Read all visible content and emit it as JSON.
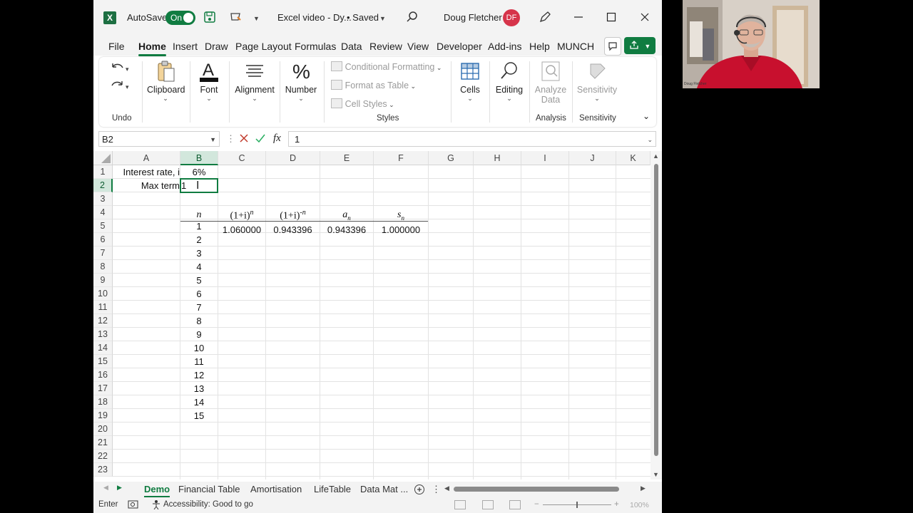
{
  "titlebar": {
    "app_icon": "X",
    "autosave_label": "AutoSave",
    "autosave_state": "On",
    "filename": "Excel video - Dy...",
    "save_status": "• Saved",
    "user_name": "Doug Fletcher",
    "user_initials": "DF"
  },
  "menu": {
    "tabs": [
      "File",
      "Home",
      "Insert",
      "Draw",
      "Page Layout",
      "Formulas",
      "Data",
      "Review",
      "View",
      "Developer",
      "Add-ins",
      "Help",
      "MUNCH"
    ],
    "active": "Home"
  },
  "ribbon": {
    "undo_group": "Undo",
    "clipboard": "Clipboard",
    "font": "Font",
    "alignment": "Alignment",
    "number": "Number",
    "conditional_formatting": "Conditional Formatting",
    "format_as_table": "Format as Table",
    "cell_styles": "Cell Styles",
    "styles_group": "Styles",
    "cells": "Cells",
    "editing": "Editing",
    "analyze_data_1": "Analyze",
    "analyze_data_2": "Data",
    "analysis_group": "Analysis",
    "sensitivity": "Sensitivity",
    "sensitivity_group": "Sensitivity"
  },
  "formula_bar": {
    "name_box": "B2",
    "fx": "fx",
    "content": "1"
  },
  "grid": {
    "columns": [
      "A",
      "B",
      "C",
      "D",
      "E",
      "F",
      "G",
      "H",
      "I",
      "J",
      "K"
    ],
    "selected_column": "B",
    "selected_row": "2",
    "rows": [
      "1",
      "2",
      "3",
      "4",
      "5",
      "6",
      "7",
      "8",
      "9",
      "10",
      "11",
      "12",
      "13",
      "14",
      "15",
      "16",
      "17",
      "18",
      "19",
      "20",
      "21",
      "22",
      "23"
    ],
    "cells": {
      "A1": "Interest rate, i",
      "B1": "6%",
      "A2": "Max term",
      "B2": "1",
      "B4": "n",
      "C4_base": "(1+i)",
      "C4_exp": "n",
      "D4_base": "(1+i)",
      "D4_exp": "-n",
      "E4_base": "a",
      "E4_sub": "n",
      "F4_base": "s",
      "F4_sub": "n",
      "C5": "1.060000",
      "D5": "0.943396",
      "E5": "0.943396",
      "F5": "1.000000"
    },
    "n_values": [
      "1",
      "2",
      "3",
      "4",
      "5",
      "6",
      "7",
      "8",
      "9",
      "10",
      "11",
      "12",
      "13",
      "14",
      "15"
    ]
  },
  "sheets": {
    "tabs": [
      "Demo",
      "Financial Table",
      "Amortisation",
      "LifeTable",
      "Data Mat ..."
    ],
    "active": "Demo"
  },
  "status": {
    "mode": "Enter",
    "accessibility": "Accessibility: Good to go",
    "zoom": "100%"
  },
  "webcam": {
    "caption": "Doug Fletcher"
  },
  "colors": {
    "excel_green": "#107c41",
    "avatar_red": "#d6344a",
    "shirt_red": "#c8102e"
  }
}
